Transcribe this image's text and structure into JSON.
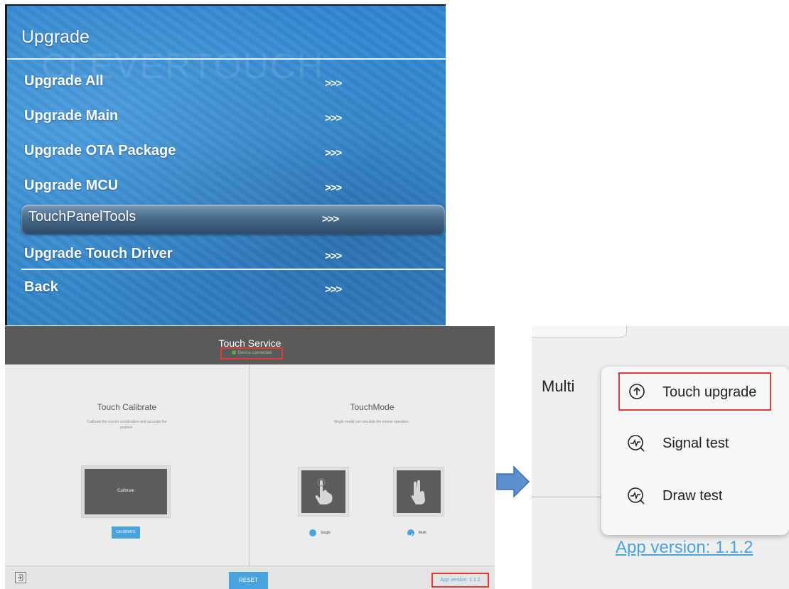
{
  "upgrade_menu": {
    "watermark": "CLEVERTOUCH",
    "title": "Upgrade",
    "selected_index": 4,
    "items": [
      {
        "label": "Upgrade All",
        "arrow": ">>>"
      },
      {
        "label": "Upgrade Main",
        "arrow": ">>>"
      },
      {
        "label": "Upgrade OTA Package",
        "arrow": ">>>"
      },
      {
        "label": "Upgrade MCU",
        "arrow": ">>>"
      },
      {
        "label": "TouchPanelTools",
        "arrow": ">>>"
      },
      {
        "label": "Upgrade Touch Driver",
        "arrow": ">>>"
      },
      {
        "label": "Back",
        "arrow": ">>>"
      }
    ]
  },
  "touch_service": {
    "title": "Touch Service",
    "status": "Device connected",
    "calibrate_section": {
      "title": "Touch Calibrate",
      "description": "Calibrate the screen coordination and accurate the position.",
      "preview_label": "Calibrate",
      "button_label": "CALIBRATE"
    },
    "mode_section": {
      "title": "TouchMode",
      "description": "Single model can simulate the mouse operation.",
      "options": [
        {
          "label": "Single",
          "selected": false
        },
        {
          "label": "Multi",
          "selected": true
        }
      ]
    },
    "footer": {
      "reset_label": "RESET",
      "app_version": "App version: 1.1.2"
    }
  },
  "zoom": {
    "mode_label": "Multi",
    "app_version": "App version: 1.1.2",
    "popup_items": [
      {
        "label": "Touch upgrade",
        "icon": "upload-arrow-icon",
        "highlighted": true
      },
      {
        "label": "Signal test",
        "icon": "signal-wave-icon",
        "highlighted": false
      },
      {
        "label": "Draw test",
        "icon": "signal-wave-icon",
        "highlighted": false
      }
    ]
  },
  "colors": {
    "accent": "#4aa3df",
    "highlight": "#e53935",
    "menu_blue": "#3a92d9"
  }
}
